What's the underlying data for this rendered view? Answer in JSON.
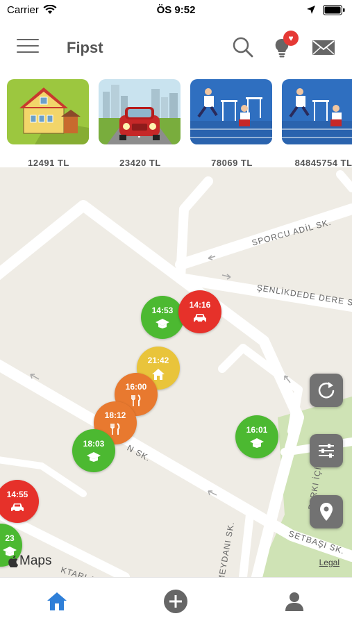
{
  "status_bar": {
    "carrier": "Carrier",
    "time": "ÖS 9:52"
  },
  "header": {
    "title": "Fipst",
    "notification_badge": "♥"
  },
  "categories": [
    {
      "price": "12491 TL",
      "image": "house"
    },
    {
      "price": "23420 TL",
      "image": "car"
    },
    {
      "price": "78069 TL",
      "image": "hurdle-race"
    },
    {
      "price": "84845754 TL",
      "image": "hurdle-race"
    }
  ],
  "map": {
    "streets": {
      "sporcu": "SPORCU ADİL SK.",
      "senlikdede": "ŞENLİKDEDE DERE S",
      "setbasi": "SETBAŞI SK.",
      "meydani": "MEYDANI SK.",
      "tarlar": "KTARLAR SK.",
      "parki": "PARKI İÇİ YO",
      "n_sk": "N SK."
    },
    "pins": [
      {
        "time": "14:53",
        "color": "green",
        "icon": "graduation-cap-icon"
      },
      {
        "time": "14:16",
        "color": "red",
        "icon": "car-icon"
      },
      {
        "time": "21:42",
        "color": "yellow",
        "icon": "home-icon"
      },
      {
        "time": "16:00",
        "color": "orange",
        "icon": "fork-knife-icon"
      },
      {
        "time": "18:12",
        "color": "orange",
        "icon": "fork-knife-icon"
      },
      {
        "time": "18:03",
        "color": "green",
        "icon": "graduation-cap-icon"
      },
      {
        "time": "16:01",
        "color": "green",
        "icon": "graduation-cap-icon"
      },
      {
        "time": "14:55",
        "color": "red",
        "icon": "car-icon"
      },
      {
        "time": "23",
        "color": "green",
        "icon": "graduation-cap-icon"
      }
    ],
    "attribution": "Maps",
    "legal": "Legal"
  },
  "colors": {
    "green": "#4cb931",
    "red": "#e6312a",
    "orange": "#e8792f",
    "yellow": "#e9c43b",
    "tab_active": "#2f7fd8",
    "tab_inactive": "#666666"
  },
  "tabs": [
    "home-icon",
    "add-icon",
    "profile-icon"
  ]
}
